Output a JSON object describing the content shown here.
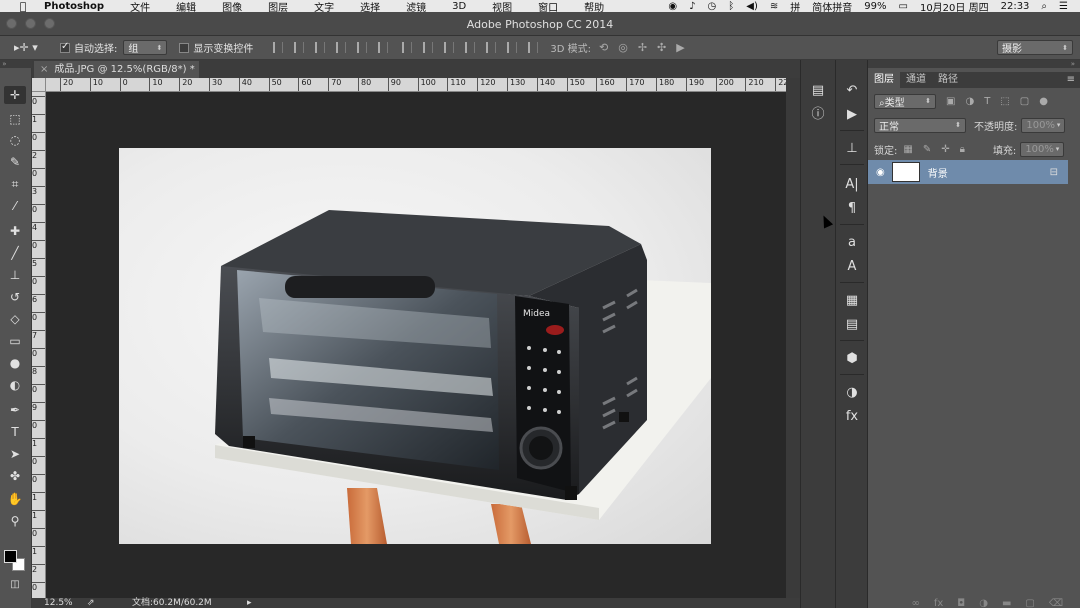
{
  "menubar": {
    "app_name": "Photoshop",
    "items": [
      "文件",
      "编辑",
      "图像",
      "图层",
      "文字",
      "选择",
      "滤镜",
      "3D",
      "视图",
      "窗口",
      "帮助"
    ],
    "input_method": "简体拼音",
    "battery": "99%",
    "date": "10月20日 周四",
    "time": "22:33"
  },
  "window": {
    "title": "Adobe Photoshop CC 2014"
  },
  "options": {
    "auto_select_label": "自动选择:",
    "auto_select_value": "组",
    "show_transform_label": "显示变换控件",
    "mode_3d_label": "3D 模式:",
    "workspace": "摄影"
  },
  "document": {
    "tab_label": "成品.JPG @ 12.5%(RGB/8*) *",
    "zoom": "12.5%",
    "doc_info": "文档:60.2M/60.2M",
    "ruler_h": [
      "20",
      "10",
      "0",
      "10",
      "20",
      "30",
      "40",
      "50",
      "60",
      "70",
      "80",
      "90",
      "100",
      "110",
      "120",
      "130",
      "140",
      "150",
      "160",
      "170",
      "180",
      "190",
      "200",
      "210",
      "22"
    ],
    "ruler_v": [
      "0",
      "1",
      "0",
      "2",
      "0",
      "3",
      "0",
      "4",
      "0",
      "5",
      "0",
      "6",
      "0",
      "7",
      "0",
      "8",
      "0",
      "9",
      "0",
      "1",
      "0",
      "0",
      "1",
      "1",
      "0",
      "1",
      "2",
      "0"
    ],
    "photo_brand": "Midea"
  },
  "layers_panel": {
    "tabs": [
      "图层",
      "通道",
      "路径"
    ],
    "filter_type": "类型",
    "blend_mode": "正常",
    "opacity_label": "不透明度:",
    "opacity_value": "100%",
    "lock_label": "锁定:",
    "fill_label": "填充:",
    "fill_value": "100%",
    "layers": [
      {
        "name": "背景",
        "visible": true,
        "locked": true
      }
    ]
  },
  "colors": {
    "accent_layer": "#6f8bab",
    "panel": "#535353",
    "canvas": "#282828"
  }
}
